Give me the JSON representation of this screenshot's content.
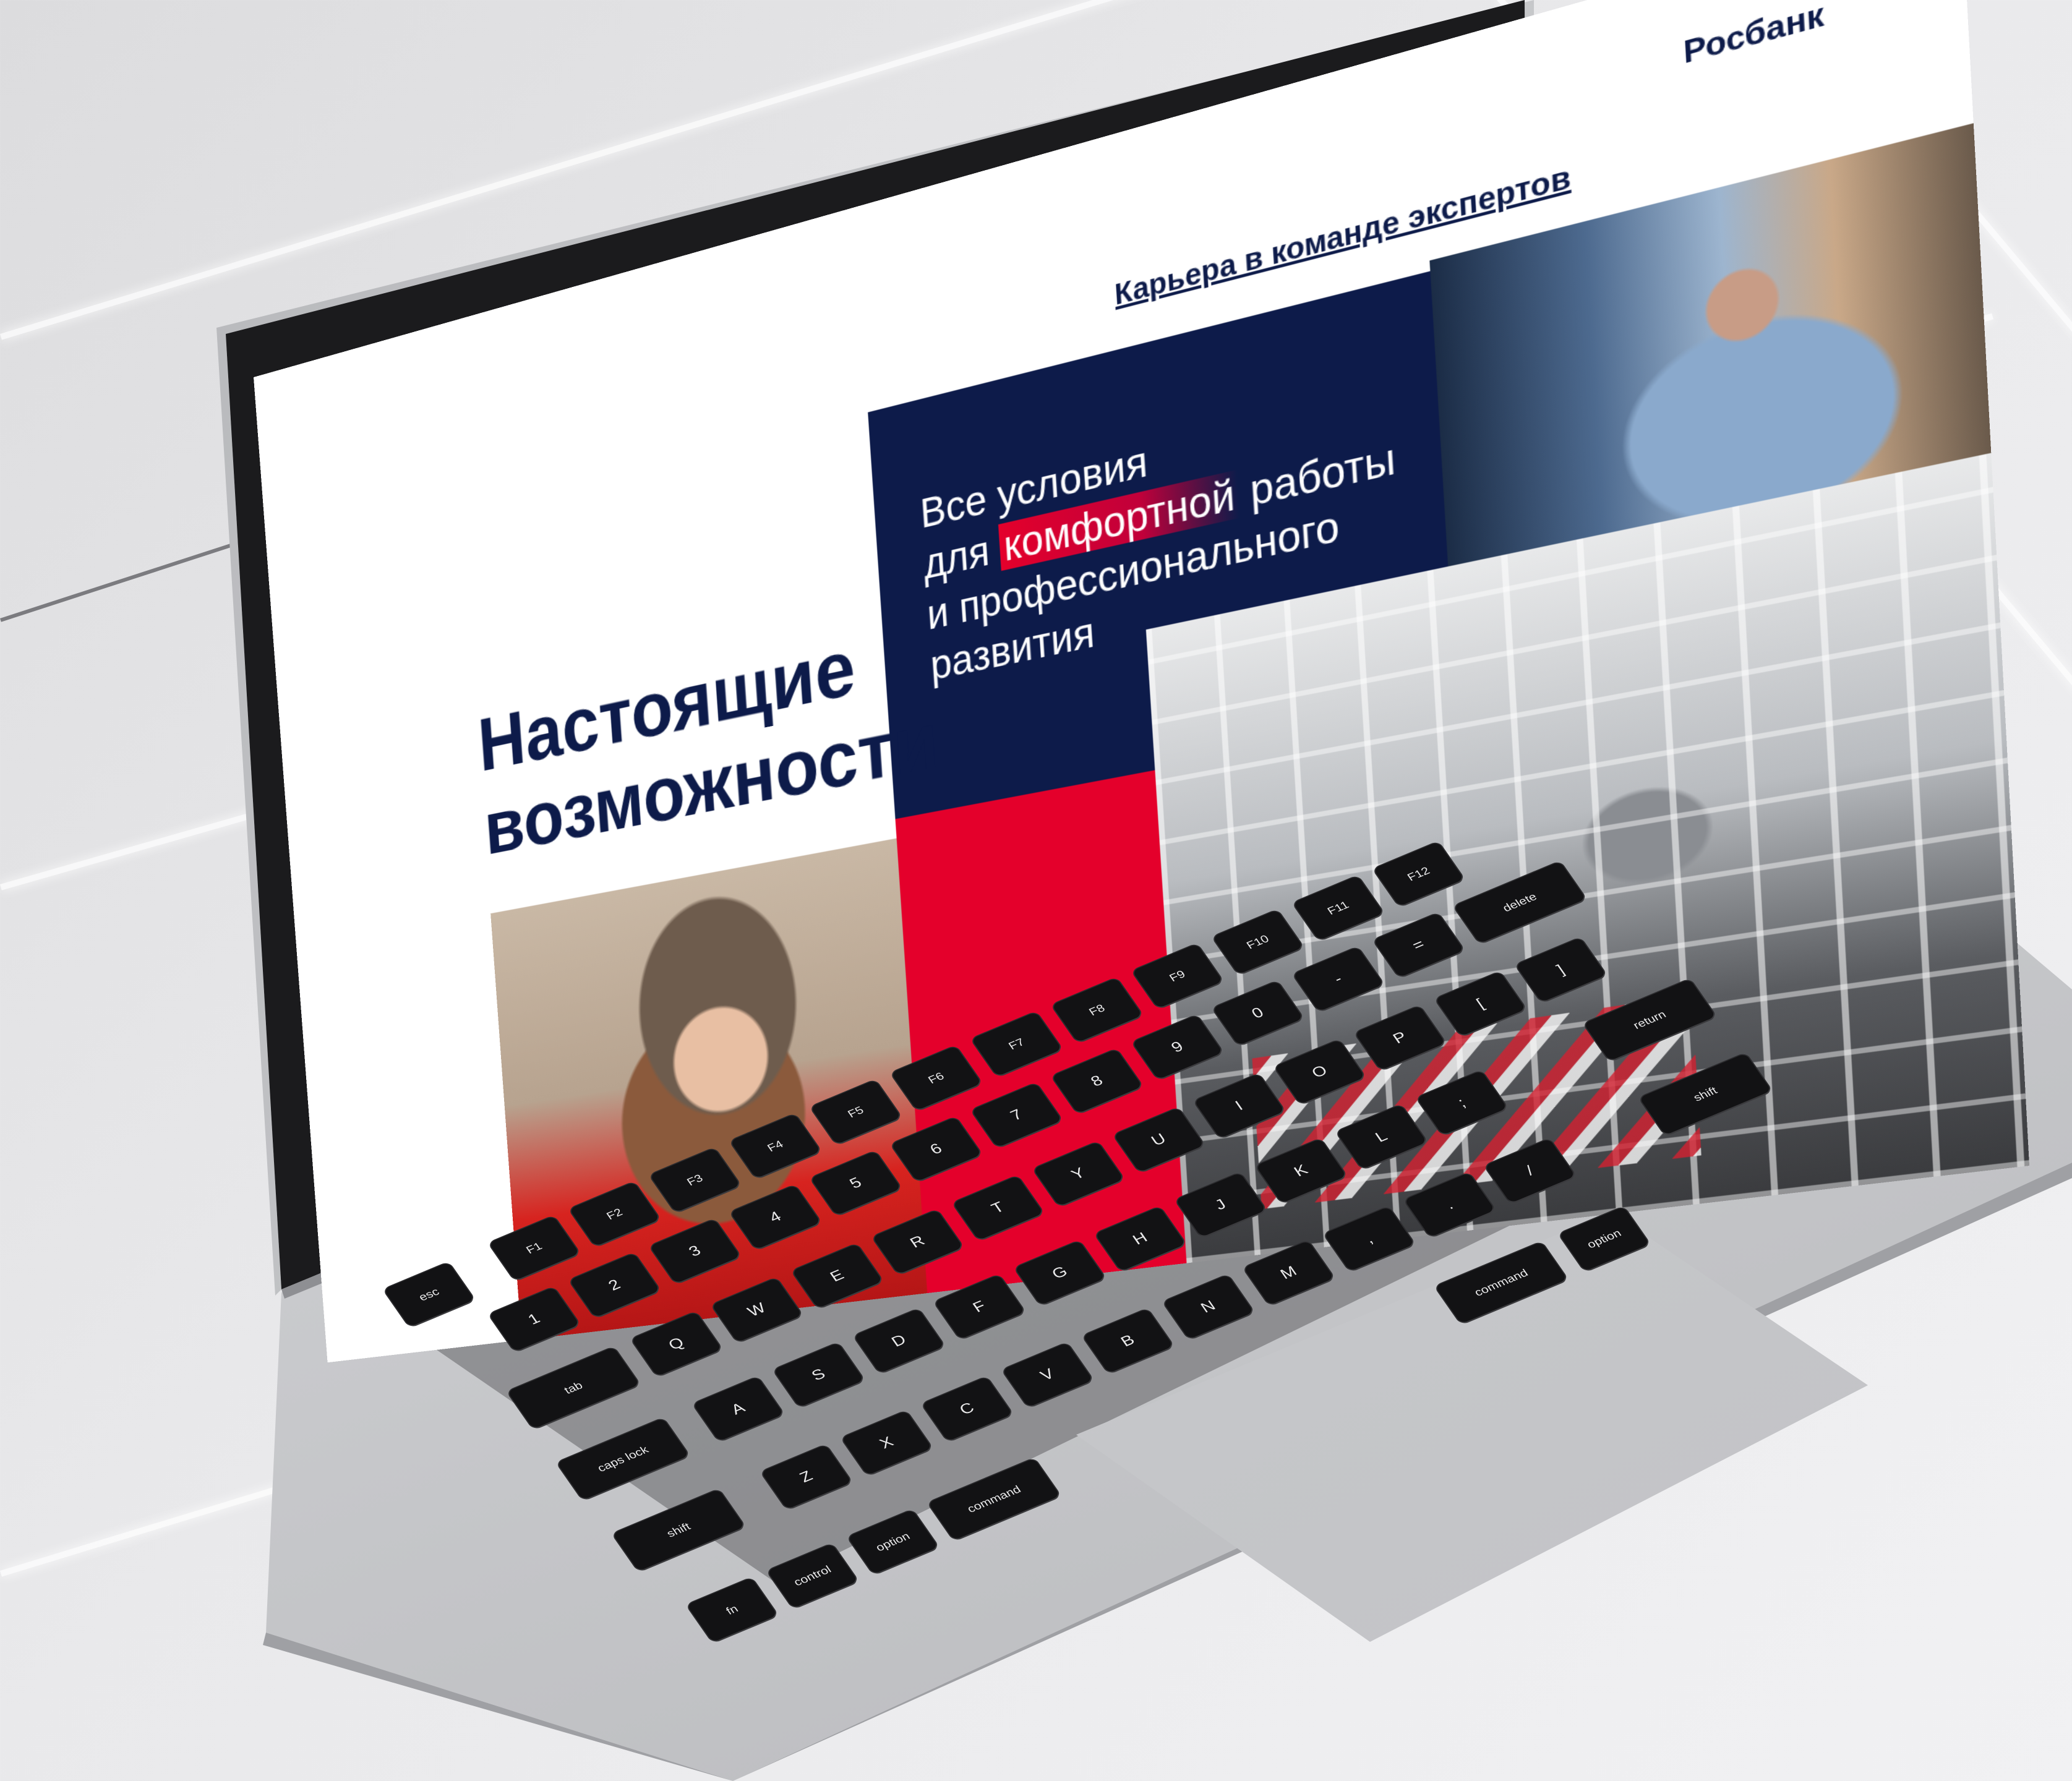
{
  "site": {
    "brand": "Росбанк",
    "career_link": "Карьера в команде экспертов",
    "headline_line1": "Настоящие",
    "headline_line2": "возможности",
    "slogan_line1": "Все условия",
    "slogan_line2_pre": "для ",
    "slogan_line2_hl": "комфортной",
    "slogan_line2_post": " работы",
    "slogan_line3": "и профессионального",
    "slogan_line4": "развития"
  },
  "colors": {
    "navy": "#0d1b4a",
    "red": "#e4002b",
    "white": "#ffffff"
  },
  "keyboard": {
    "keys": [
      "esc",
      "F1",
      "F2",
      "F3",
      "F4",
      "F5",
      "F6",
      "F7",
      "F8",
      "F9",
      "F10",
      "F11",
      "F12",
      "1",
      "2",
      "3",
      "4",
      "5",
      "6",
      "7",
      "8",
      "9",
      "0",
      "-",
      "=",
      "delete",
      "tab",
      "Q",
      "W",
      "E",
      "R",
      "T",
      "Y",
      "U",
      "I",
      "O",
      "P",
      "[",
      "]",
      "caps lock",
      "A",
      "S",
      "D",
      "F",
      "G",
      "H",
      "J",
      "K",
      "L",
      ";",
      "return",
      "shift",
      "Z",
      "X",
      "C",
      "V",
      "B",
      "N",
      "M",
      ",",
      ".",
      "/",
      "shift",
      "fn",
      "control",
      "option",
      "command",
      "command",
      "option"
    ]
  }
}
